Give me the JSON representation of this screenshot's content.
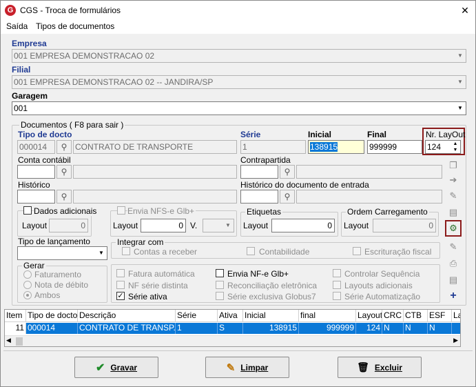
{
  "window": {
    "title": "CGS - Troca de formulários",
    "close_glyph": "✕",
    "logo_letter": "G"
  },
  "menu": [
    "Saída",
    "Tipos de documentos"
  ],
  "empresa": {
    "label": "Empresa",
    "value": "001 EMPRESA DEMONSTRACAO 02"
  },
  "filial": {
    "label": "Filial",
    "value": "001 EMPRESA DEMONSTRACAO 02 -- JANDIRA/SP"
  },
  "garagem": {
    "label": "Garagem",
    "value": "001"
  },
  "documentos": {
    "title": "Documentos ( F8 para sair )",
    "tipo_docto": {
      "label": "Tipo de docto",
      "code": "000014",
      "desc": "CONTRATO DE TRANSPORTE"
    },
    "serie": {
      "label": "Série",
      "value": "1"
    },
    "inicial": {
      "label": "Inicial",
      "value": "138915"
    },
    "final": {
      "label": "Final",
      "value": "999999"
    },
    "nr_layout": {
      "label": "Nr. LayOut",
      "value": "124"
    },
    "conta_contabil": {
      "label": "Conta contábil"
    },
    "contrapartida": {
      "label": "Contrapartida"
    },
    "historico": {
      "label": "Histórico"
    },
    "historico_entrada": {
      "label": "Histórico do documento de entrada"
    },
    "dados_adicionais": {
      "label": "Dados adicionais",
      "layout_label": "Layout",
      "layout_value": "0"
    },
    "envia_nfse": {
      "label": "Envia NFS-e Glb+",
      "layout_label": "Layout",
      "layout_value": "0",
      "v_label": "V."
    },
    "etiquetas": {
      "label": "Etiquetas",
      "layout_label": "Layout",
      "layout_value": "0"
    },
    "ordem": {
      "label": "Ordem Carregamento",
      "layout_label": "Layout",
      "layout_value": "0"
    },
    "tipo_lancamento": {
      "label": "Tipo de lançamento",
      "value": ""
    },
    "integrar": {
      "label": "Integrar com",
      "options": [
        "Contas a receber",
        "Contabilidade",
        "Escrituração fiscal"
      ]
    },
    "gerar": {
      "label": "Gerar",
      "options": [
        "Faturamento",
        "Nota de débito",
        "Ambos"
      ]
    },
    "flags": {
      "fatura_automatica": "Fatura automática",
      "nf_serie_distinta": "NF série distinta",
      "serie_ativa": "Série ativa",
      "envia_nfe": "Envia NF-e Glb+",
      "reconciliacao": "Reconciliação eletrônica",
      "serie_exclusiva": "Série exclusiva Globus7",
      "controlar_sequencia": "Controlar Sequência",
      "layouts_adicionais": "Layouts adicionais",
      "serie_automatizacao": "Série Automatização"
    }
  },
  "grid": {
    "columns": [
      "Item",
      "Tipo de docto",
      "Descrição",
      "Série",
      "Ativa",
      "Inicial",
      "final",
      "Layout",
      "CRC",
      "CTB",
      "ESF",
      "La"
    ],
    "rows": [
      [
        "11",
        "000014",
        "CONTRATO DE TRANSP...",
        "1",
        "S",
        "138915",
        "999999",
        "124",
        "N",
        "N",
        "N",
        ""
      ]
    ]
  },
  "buttons": {
    "gravar": "Gravar",
    "limpar": "Limpar",
    "excluir": "Excluir"
  },
  "colors": {
    "accent": "#1f3a93",
    "selection": "#0a78d7",
    "highlight_border": "#8b1a1a",
    "logo": "#c8202b"
  }
}
